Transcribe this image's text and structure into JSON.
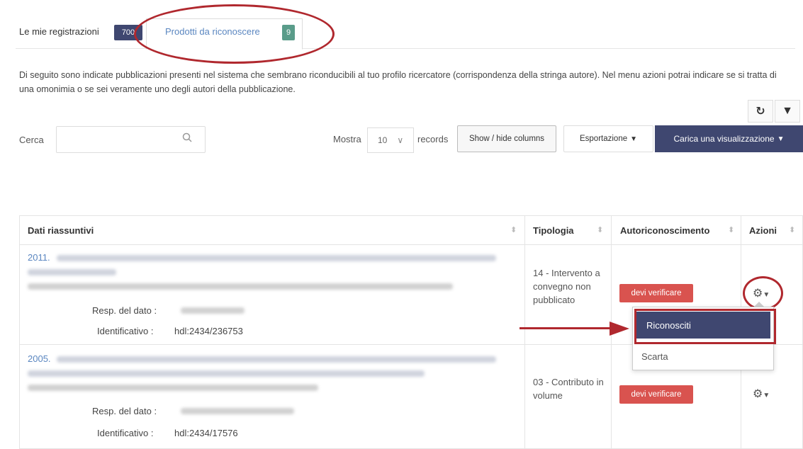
{
  "tabs": {
    "registrations_label": "Le mie registrazioni",
    "registrations_count": "700",
    "to_recognize_label": "Prodotti da riconoscere",
    "to_recognize_count": "9"
  },
  "description": "Di seguito sono indicate pubblicazioni presenti nel sistema che sembrano riconducibili al tuo profilo ricercatore (corrispondenza della stringa autore). Nel menu azioni potrai indicare se si tratta di una omonimia o se sei veramente uno degli autori della pubblicazione.",
  "toolbar": {
    "refresh_icon": "refresh-icon",
    "filter_icon": "filter-icon",
    "search_label": "Cerca",
    "search_placeholder": "",
    "show_label": "Mostra",
    "page_size": "10",
    "records_label": "records",
    "showhide_label": "Show / hide columns",
    "export_label": "Esportazione",
    "load_view_label": "Carica una visualizzazione"
  },
  "table": {
    "columns": [
      "Dati riassuntivi",
      "Tipologia",
      "Autoriconoscimento",
      "Azioni"
    ],
    "rows": [
      {
        "year": "2011.",
        "resp_label": "Resp. del dato :",
        "id_label": "Identificativo :",
        "id_value": "hdl:2434/236753",
        "tipologia": "14 - Intervento a convegno non pubblicato",
        "status": "devi verificare"
      },
      {
        "year": "2005.",
        "resp_label": "Resp. del dato :",
        "id_label": "Identificativo :",
        "id_value": "hdl:2434/17576",
        "tipologia": "03 - Contributo in volume",
        "status": "devi verificare"
      }
    ]
  },
  "actions_menu": {
    "items": [
      "Riconosciti",
      "Scarta"
    ]
  },
  "colors": {
    "primary": "#3f4770",
    "teal": "#5a9c8a",
    "danger": "#d9534f",
    "annotation": "#b0282e",
    "link": "#5a86c0"
  }
}
